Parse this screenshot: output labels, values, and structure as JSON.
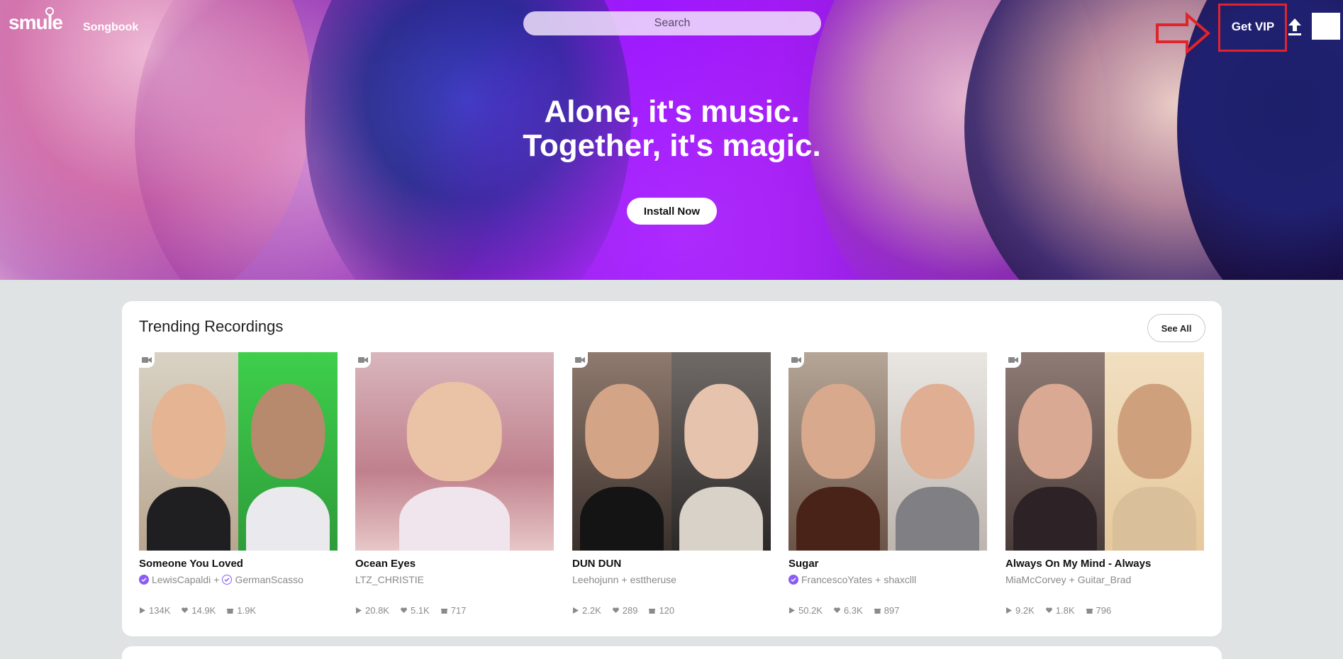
{
  "header": {
    "logo_text": "smule",
    "nav_songbook": "Songbook",
    "search_placeholder": "Search",
    "get_vip_label": "Get VIP",
    "upload_icon": "upload-icon",
    "colors": {
      "hero_purple": "#9d16ff",
      "highlight_red": "#e0242b"
    }
  },
  "hero": {
    "tagline_line1": "Alone, it's music.",
    "tagline_line2": "Together, it's magic.",
    "install_label": "Install Now"
  },
  "trending": {
    "title": "Trending Recordings",
    "see_all_label": "See All",
    "recordings": [
      {
        "title": "Someone You Loved",
        "artist1": "LewisCapaldi",
        "joiner": "+",
        "artist2": "GermanScasso",
        "plays": "134K",
        "likes": "14.9K",
        "gifts": "1.9K"
      },
      {
        "title": "Ocean Eyes",
        "artist1": "LTZ_CHRISTIE",
        "joiner": "",
        "artist2": "",
        "plays": "20.8K",
        "likes": "5.1K",
        "gifts": "717"
      },
      {
        "title": "DUN DUN",
        "artist1": "Leehojunn",
        "joiner": "+",
        "artist2": "esttheruse",
        "plays": "2.2K",
        "likes": "289",
        "gifts": "120"
      },
      {
        "title": "Sugar",
        "artist1": "FrancescoYates",
        "joiner": "+",
        "artist2": "shaxclll",
        "plays": "50.2K",
        "likes": "6.3K",
        "gifts": "897"
      },
      {
        "title": "Always On My Mind - Always",
        "artist1": "MiaMcCorvey",
        "joiner": "+",
        "artist2": "Guitar_Brad",
        "plays": "9.2K",
        "likes": "1.8K",
        "gifts": "796"
      }
    ]
  }
}
